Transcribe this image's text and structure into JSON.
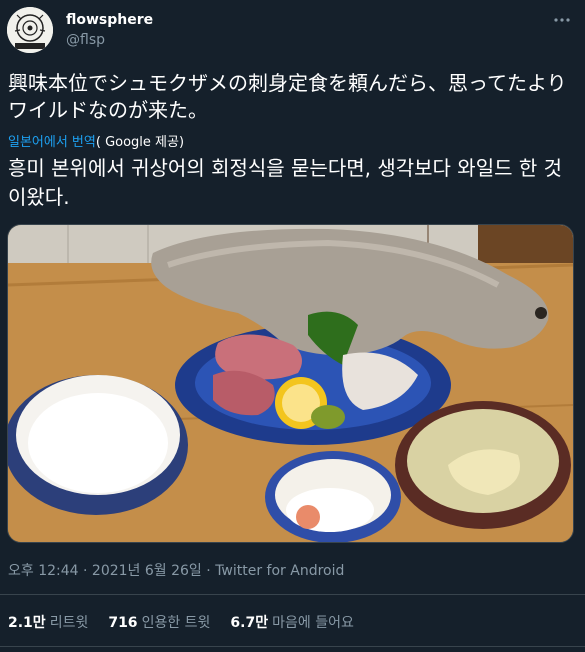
{
  "account": {
    "name": "flowsphere",
    "handle": "@flsp"
  },
  "tweet": {
    "original_text": "興味本位でシュモクザメの刺身定食を頼んだら、思ってたよりワイルドなのが来た。",
    "translate_label": "일본어에서 번역",
    "translate_provider": "( Google 제공)",
    "translated_text": "흥미 본위에서 귀상어의 회정식을 묻는다면, 생각보다 와일드 한 것이왔다."
  },
  "meta": {
    "time": "오후 12:44",
    "date": "2021년 6월 26일",
    "client": "Twitter for Android",
    "separator": "·"
  },
  "stats": {
    "retweets_count": "2.1만",
    "retweets_label": "리트윗",
    "quotes_count": "716",
    "quotes_label": "인용한 트윗",
    "likes_count": "6.7만",
    "likes_label": "마음에 들어요"
  },
  "icons": {
    "more": "more-horizontal-icon"
  },
  "colors": {
    "background": "#15202b",
    "secondary_text": "#8899a6",
    "link": "#1da1f2",
    "divider": "#38444d"
  }
}
